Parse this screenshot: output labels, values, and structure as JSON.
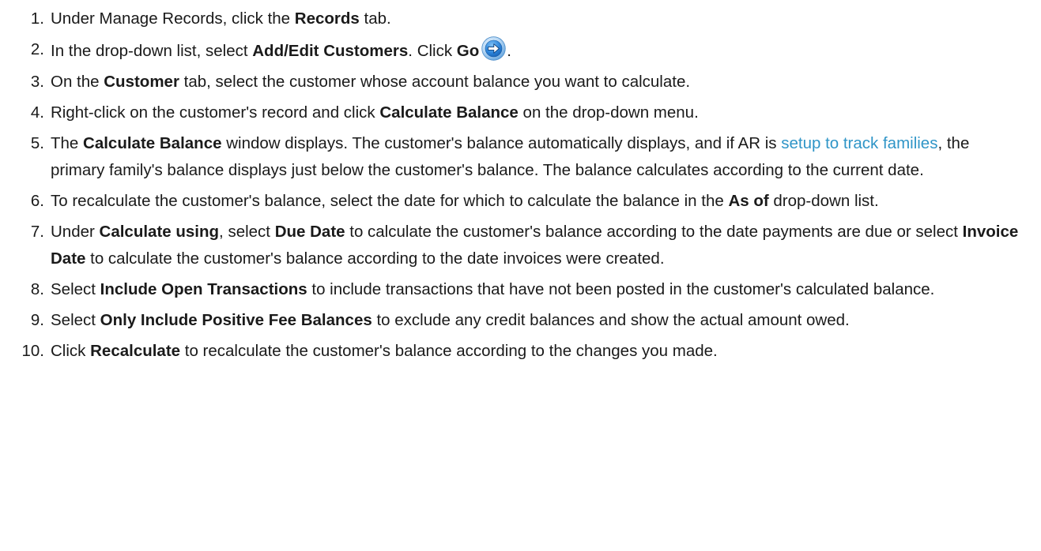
{
  "steps": [
    {
      "number": "1.",
      "parts": [
        "Under Manage Records, click the ",
        "Records",
        " tab."
      ]
    },
    {
      "number": "2.",
      "parts": [
        "In the drop-down list, select ",
        "Add/Edit Customers",
        ". Click ",
        "Go",
        "."
      ],
      "icon": "go-arrow-icon"
    },
    {
      "number": "3.",
      "parts": [
        "On the ",
        "Customer",
        " tab, select the customer whose account balance you want to calculate."
      ]
    },
    {
      "number": "4.",
      "parts": [
        "Right-click on the customer's record and click ",
        "Calculate Balance",
        " on the drop-down menu."
      ]
    },
    {
      "number": "5.",
      "parts": [
        "The ",
        "Calculate Balance",
        " window displays. The customer's balance automatically displays, and if AR is ",
        "setup to track families",
        ", the primary family's balance displays just below the customer's balance. The balance calculates according to the current date."
      ]
    },
    {
      "number": "6.",
      "parts": [
        "To recalculate the customer's balance, select the date for which to calculate the balance in the ",
        "As of",
        " drop-down list."
      ]
    },
    {
      "number": "7.",
      "parts": [
        "Under ",
        "Calculate using",
        ", select ",
        "Due Date",
        " to calculate the customer's balance according to the date payments are due or select ",
        "Invoice Date",
        " to calculate the customer's balance according to the date invoices were created."
      ]
    },
    {
      "number": "8.",
      "parts": [
        "Select ",
        "Include Open Transactions",
        " to include transactions that have not been posted in the customer's calculated balance."
      ]
    },
    {
      "number": "9.",
      "parts": [
        "Select ",
        "Only Include Positive Fee Balances",
        " to exclude any credit balances and show the actual amount owed."
      ]
    },
    {
      "number": "10.",
      "parts": [
        "Click ",
        "Recalculate",
        " to recalculate the customer's balance according to the changes you made."
      ]
    }
  ],
  "colors": {
    "link": "#2f95c7",
    "text": "#1a1a1a",
    "icon_ring": "#3a8fd6"
  }
}
